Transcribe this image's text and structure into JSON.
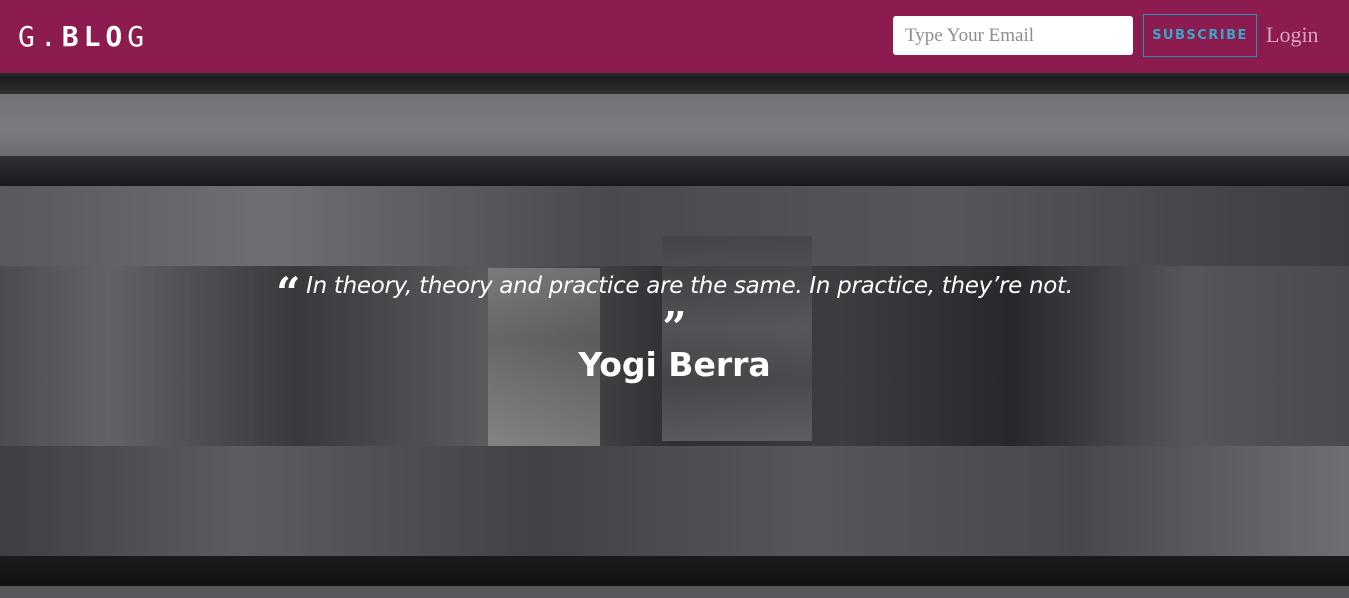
{
  "header": {
    "logo_text_1": "G.",
    "logo_text_2": "BLO",
    "logo_text_3": "G",
    "email_placeholder": "Type Your Email",
    "subscribe_label": "SUBSCRIBE",
    "login_label": "Login"
  },
  "hero": {
    "quote_text": "In theory, theory and practice are the same. In practice, they’re not.",
    "quote_open_mark": "“",
    "quote_close_mark": "”",
    "author": "Yogi Berra"
  },
  "colors": {
    "header_bg": "#8c1b4f",
    "subscribe_accent": "#38a7c9",
    "login_text": "#d4a7bd"
  }
}
